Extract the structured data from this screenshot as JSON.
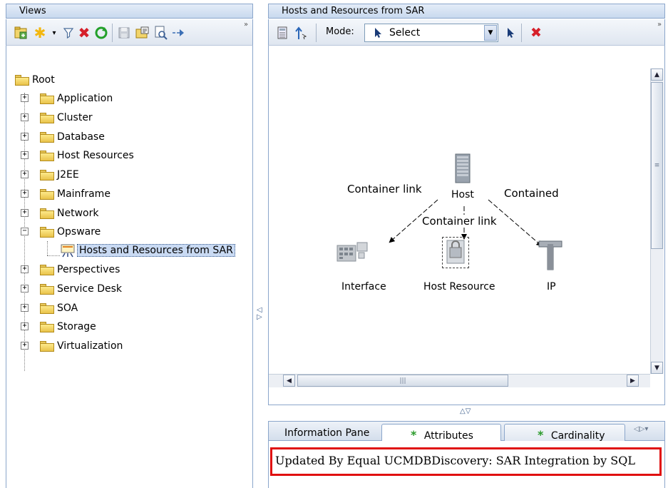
{
  "views_panel": {
    "title": "Views",
    "tree": {
      "root": "Root",
      "items": [
        {
          "label": "Application",
          "expanded": false
        },
        {
          "label": "Cluster",
          "expanded": false
        },
        {
          "label": "Database",
          "expanded": false
        },
        {
          "label": "Host Resources",
          "expanded": false
        },
        {
          "label": "J2EE",
          "expanded": false
        },
        {
          "label": "Mainframe",
          "expanded": false
        },
        {
          "label": "Network",
          "expanded": false
        },
        {
          "label": "Opsware",
          "expanded": true
        },
        {
          "label": "Hosts and Resources from SAR",
          "selected": true,
          "child": true
        },
        {
          "label": "Perspectives",
          "expanded": false
        },
        {
          "label": "Service Desk",
          "expanded": false
        },
        {
          "label": "SOA",
          "expanded": false
        },
        {
          "label": "Storage",
          "expanded": false
        },
        {
          "label": "Virtualization",
          "expanded": false
        }
      ]
    },
    "expand_symbol": "+",
    "collapse_symbol": "−",
    "more_symbol": "»"
  },
  "map_panel": {
    "title": "Hosts and Resources from SAR",
    "mode_label": "Mode:",
    "mode_value": "Select",
    "more_symbol": "»",
    "nodes": {
      "host": "Host",
      "interface": "Interface",
      "host_resource": "Host Resource",
      "ip": "IP"
    },
    "links": {
      "left": "Container link",
      "center": "Container link",
      "right": "Contained"
    }
  },
  "splitter": {
    "vertical_arrows": "◁▷",
    "horizontal_arrows": "△▽"
  },
  "info_pane": {
    "tabs": [
      {
        "label": "Information Pane",
        "active": false
      },
      {
        "label": "Attributes",
        "active": true,
        "star": "*"
      },
      {
        "label": "Cardinality",
        "active": false,
        "star": "*"
      }
    ],
    "content": "Updated By Equal UCMDBDiscovery: SAR Integration by SQL"
  },
  "colors": {
    "accent_red": "#e01010",
    "panel_border": "#8ba6cb",
    "selection": "#c9daf3"
  }
}
